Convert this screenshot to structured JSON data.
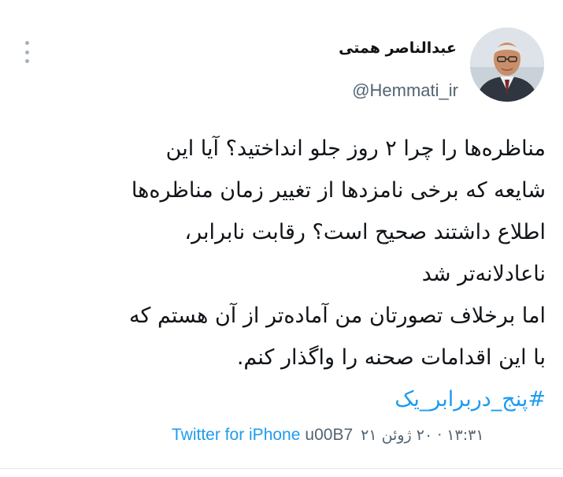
{
  "tweet": {
    "author_name": "عبدالناصر همتی",
    "author_handle": "@Hemmati_ir",
    "avatar": "profile-photo",
    "more_icon": "more-options-icon",
    "body_lines": [
      "مناظره‌ها را چرا ۲ روز جلو انداختید؟ آیا این",
      "شایعه که برخی نامزدها از تغییر زمان مناظره‌ها",
      "اطلاع داشتند صحیح است؟ رقابت نابرابر،",
      "ناعادلانه‌تر شد",
      "اما برخلاف تصورتان من آماده‌تر از آن هستم که",
      "با این اقدامات صحنه را واگذار کنم."
    ],
    "hashtag": "#پنج_دربرابر_یک",
    "date": "۱۳:۳۱ · ۲۰ ژوئن ۲۱",
    "separator": "u00B7",
    "source": "Twitter for iPhone",
    "colors": {
      "link": "#1d9bf0",
      "secondary_text": "#536471",
      "body_text": "#101418"
    }
  }
}
